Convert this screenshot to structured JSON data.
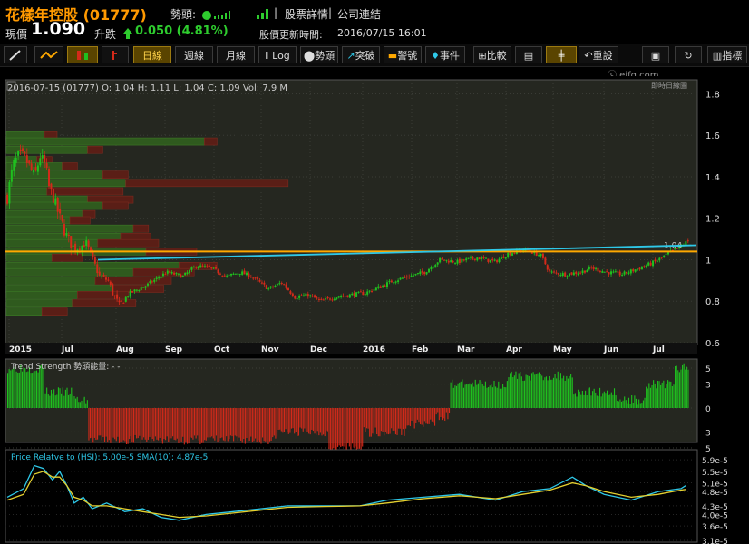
{
  "header": {
    "name": "花樣年控股 (01777)",
    "trend_label": "勢頭:",
    "links": [
      "股票詳情",
      "公司連結"
    ],
    "link_sep": "|",
    "price_label": "現價",
    "price": "1.090",
    "change_label": "升跌",
    "change": "0.050 (4.81%)",
    "update_label": "股價更新時間:",
    "update_time": "2016/07/15 16:01"
  },
  "toolbar": {
    "buttons": [
      "日線",
      "週線",
      "月線",
      "Log",
      "勢頭",
      "突破",
      "警號",
      "事件",
      "比較",
      "重設",
      "指標"
    ],
    "active": "日線"
  },
  "watermark": "ⓒ ejfq.com",
  "subtitle_right": "即時日線圖",
  "colors": {
    "bg": "#000000",
    "panel": "#252720",
    "up": "#1fc01f",
    "down": "#d42a1a",
    "gold": "#ffa800",
    "cyan": "#2ec8e8",
    "yellow": "#e4d030",
    "title": "#ff9900"
  },
  "chart_data": [
    {
      "type": "candlestick",
      "info": "2016-07-15 (01777) O: 1.04 H: 1.11 L: 1.04 C: 1.09 Vol: 7.9 M",
      "x_labels": [
        "2015",
        "Jul",
        "Aug",
        "Sep",
        "Oct",
        "Nov",
        "Dec",
        "2016",
        "Feb",
        "Mar",
        "Apr",
        "May",
        "Jun",
        "Jul"
      ],
      "y_ticks": [
        1.8,
        1.6,
        1.4,
        1.2,
        1,
        0.8,
        0.6
      ],
      "ylim": [
        0.6,
        1.85
      ],
      "horizontal_line": 1.04,
      "horizontal_line_label": "1.04",
      "trend_line": {
        "from": [
          "Aug",
          1.0
        ],
        "to": [
          "Jul",
          1.07
        ]
      },
      "close_path": [
        [
          0,
          1.3
        ],
        [
          5,
          1.45
        ],
        [
          10,
          1.5
        ],
        [
          15,
          1.5
        ],
        [
          20,
          1.45
        ],
        [
          25,
          1.4
        ],
        [
          30,
          1.5
        ],
        [
          35,
          1.45
        ],
        [
          38,
          1.35
        ],
        [
          42,
          1.3
        ],
        [
          48,
          1.2
        ],
        [
          55,
          1.1
        ],
        [
          62,
          1.05
        ],
        [
          72,
          1.08
        ],
        [
          84,
          0.92
        ],
        [
          92,
          0.9
        ],
        [
          96,
          0.84
        ],
        [
          102,
          0.78
        ],
        [
          112,
          0.84
        ],
        [
          128,
          0.88
        ],
        [
          145,
          0.94
        ],
        [
          160,
          0.92
        ],
        [
          172,
          0.97
        ],
        [
          185,
          0.96
        ],
        [
          200,
          0.92
        ],
        [
          212,
          0.94
        ],
        [
          222,
          0.92
        ],
        [
          238,
          0.86
        ],
        [
          250,
          0.89
        ],
        [
          262,
          0.82
        ],
        [
          274,
          0.83
        ],
        [
          286,
          0.8
        ],
        [
          298,
          0.82
        ],
        [
          312,
          0.83
        ],
        [
          326,
          0.84
        ],
        [
          340,
          0.87
        ],
        [
          352,
          0.9
        ],
        [
          366,
          0.92
        ],
        [
          380,
          0.94
        ],
        [
          394,
          1.0
        ],
        [
          410,
          0.99
        ],
        [
          428,
          1.01
        ],
        [
          444,
          0.99
        ],
        [
          456,
          1.03
        ],
        [
          472,
          1.05
        ],
        [
          486,
          1.02
        ],
        [
          494,
          0.94
        ],
        [
          508,
          0.93
        ],
        [
          522,
          0.94
        ],
        [
          532,
          0.96
        ],
        [
          546,
          0.94
        ],
        [
          560,
          0.93
        ],
        [
          576,
          0.96
        ],
        [
          590,
          0.99
        ],
        [
          602,
          1.03
        ],
        [
          612,
          1.06
        ],
        [
          620,
          1.09
        ]
      ],
      "volume_profile": [
        {
          "price": 1.6,
          "up": 0.15,
          "down": 0.05
        },
        {
          "price": 1.57,
          "up": 0.78,
          "down": 0.05
        },
        {
          "price": 1.53,
          "up": 0.32,
          "down": 0.06
        },
        {
          "price": 1.48,
          "up": 0.12,
          "down": 0.06
        },
        {
          "price": 1.45,
          "up": 0.22,
          "down": 0.06
        },
        {
          "price": 1.41,
          "up": 0.38,
          "down": 0.1
        },
        {
          "price": 1.37,
          "up": 0.47,
          "down": 0.64
        },
        {
          "price": 1.33,
          "up": 0.16,
          "down": 0.3
        },
        {
          "price": 1.29,
          "up": 0.32,
          "down": 0.18
        },
        {
          "price": 1.26,
          "up": 0.38,
          "down": 0.1
        },
        {
          "price": 1.22,
          "up": 0.3,
          "down": 0.05
        },
        {
          "price": 1.19,
          "up": 0.25,
          "down": 0.08
        },
        {
          "price": 1.15,
          "up": 0.5,
          "down": 0.06
        },
        {
          "price": 1.11,
          "up": 0.45,
          "down": 0.12
        },
        {
          "price": 1.08,
          "up": 0.36,
          "down": 0.24
        },
        {
          "price": 1.04,
          "up": 0.55,
          "down": 0.2
        },
        {
          "price": 1.01,
          "up": 0.18,
          "down": 0.12
        },
        {
          "price": 0.97,
          "up": 0.68,
          "down": 0.15
        },
        {
          "price": 0.94,
          "up": 0.5,
          "down": 0.24
        },
        {
          "price": 0.9,
          "up": 0.35,
          "down": 0.3
        },
        {
          "price": 0.86,
          "up": 0.42,
          "down": 0.2
        },
        {
          "price": 0.83,
          "up": 0.28,
          "down": 0.2
        },
        {
          "price": 0.79,
          "up": 0.26,
          "down": 0.25
        },
        {
          "price": 0.75,
          "up": 0.14,
          "down": 0.1
        }
      ]
    },
    {
      "type": "bar",
      "title": "Trend Strength 勢頭能量: - -",
      "y_ticks": [
        "5",
        "3",
        "0",
        "3",
        "5"
      ],
      "ylim": [
        -5,
        5
      ],
      "segments": [
        {
          "count": 26,
          "value": 5
        },
        {
          "count": 20,
          "value": 2
        },
        {
          "count": 10,
          "value": 1
        },
        {
          "count": 130,
          "value": -4
        },
        {
          "count": 36,
          "value": -3
        },
        {
          "count": 24,
          "value": -5
        },
        {
          "count": 30,
          "value": -3
        },
        {
          "count": 20,
          "value": -2
        },
        {
          "count": 10,
          "value": -1
        },
        {
          "count": 40,
          "value": 3
        },
        {
          "count": 45,
          "value": 4
        },
        {
          "count": 30,
          "value": 2
        },
        {
          "count": 20,
          "value": 1
        },
        {
          "count": 20,
          "value": 3
        },
        {
          "count": 10,
          "value": 5
        }
      ]
    },
    {
      "type": "line",
      "title": "Price Relatve to (HSI): 5.00e-5  SMA(10): 4.87e-5",
      "y_ticks": [
        "5.9e-5",
        "5.5e-5",
        "5.1e-5",
        "4.8e-5",
        "4.3e-5",
        "4.0e-5",
        "3.6e-5",
        "3.1e-5"
      ],
      "ylim": [
        3.1e-05,
        6e-05
      ],
      "series": [
        {
          "key": "relative",
          "color": "#2ec8e8",
          "points": [
            [
              0,
              4.6
            ],
            [
              18,
              4.9
            ],
            [
              30,
              5.7
            ],
            [
              40,
              5.6
            ],
            [
              50,
              5.2
            ],
            [
              58,
              5.5
            ],
            [
              66,
              5.0
            ],
            [
              74,
              4.4
            ],
            [
              84,
              4.6
            ],
            [
              94,
              4.2
            ],
            [
              110,
              4.4
            ],
            [
              130,
              4.1
            ],
            [
              150,
              4.2
            ],
            [
              170,
              3.9
            ],
            [
              190,
              3.8
            ],
            [
              220,
              4.0
            ],
            [
              250,
              4.1
            ],
            [
              280,
              4.2
            ],
            [
              310,
              4.3
            ],
            [
              350,
              4.3
            ],
            [
              390,
              4.3
            ],
            [
              420,
              4.5
            ],
            [
              460,
              4.6
            ],
            [
              500,
              4.7
            ],
            [
              540,
              4.5
            ],
            [
              570,
              4.8
            ],
            [
              600,
              4.9
            ],
            [
              625,
              5.3
            ],
            [
              640,
              5.0
            ],
            [
              660,
              4.7
            ],
            [
              690,
              4.5
            ],
            [
              720,
              4.8
            ],
            [
              745,
              4.9
            ],
            [
              750,
              5.0
            ]
          ]
        },
        {
          "key": "sma10",
          "color": "#e4d030",
          "points": [
            [
              0,
              4.5
            ],
            [
              18,
              4.7
            ],
            [
              30,
              5.4
            ],
            [
              40,
              5.5
            ],
            [
              50,
              5.3
            ],
            [
              58,
              5.3
            ],
            [
              66,
              5.0
            ],
            [
              74,
              4.6
            ],
            [
              84,
              4.5
            ],
            [
              94,
              4.3
            ],
            [
              110,
              4.3
            ],
            [
              130,
              4.2
            ],
            [
              150,
              4.1
            ],
            [
              170,
              4.0
            ],
            [
              190,
              3.9
            ],
            [
              220,
              3.95
            ],
            [
              250,
              4.05
            ],
            [
              280,
              4.15
            ],
            [
              310,
              4.25
            ],
            [
              350,
              4.28
            ],
            [
              390,
              4.3
            ],
            [
              420,
              4.4
            ],
            [
              460,
              4.55
            ],
            [
              500,
              4.65
            ],
            [
              540,
              4.55
            ],
            [
              570,
              4.7
            ],
            [
              600,
              4.85
            ],
            [
              625,
              5.1
            ],
            [
              640,
              5.0
            ],
            [
              660,
              4.8
            ],
            [
              690,
              4.6
            ],
            [
              720,
              4.7
            ],
            [
              745,
              4.85
            ],
            [
              750,
              4.87
            ]
          ]
        }
      ]
    }
  ]
}
